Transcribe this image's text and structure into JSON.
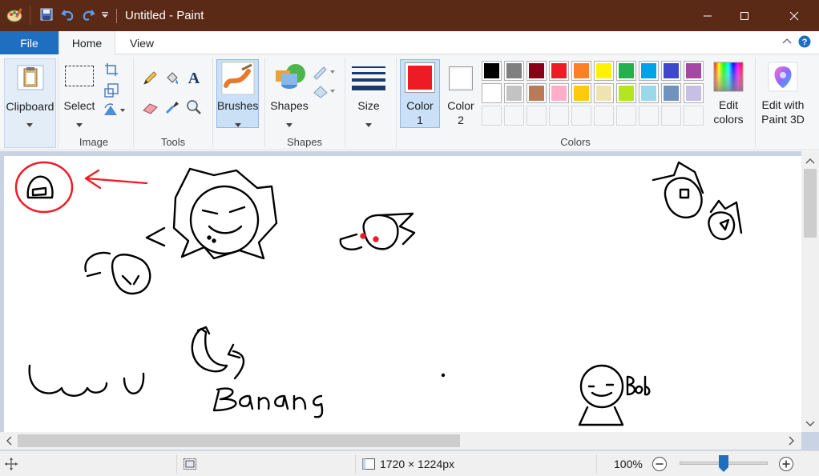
{
  "window": {
    "title": "Untitled - Paint",
    "qat_icons": [
      "paint-app-icon",
      "save-icon",
      "undo-icon",
      "redo-icon",
      "customize-qat-icon"
    ]
  },
  "tabs": {
    "file": "File",
    "home": "Home",
    "view": "View"
  },
  "ribbon": {
    "clipboard": {
      "label": "Clipboard"
    },
    "image": {
      "select_label": "Select",
      "group_label": "Image"
    },
    "tools": {
      "group_label": "Tools"
    },
    "brushes": {
      "label": "Brushes"
    },
    "shapes": {
      "label": "Shapes",
      "group_label": "Shapes"
    },
    "size": {
      "label": "Size"
    },
    "color1": {
      "label_line1": "Color",
      "label_line2": "1",
      "value": "#ed1c24"
    },
    "color2": {
      "label_line1": "Color",
      "label_line2": "2",
      "value": "#ffffff"
    },
    "colors_group_label": "Colors",
    "edit_colors": {
      "line1": "Edit",
      "line2": "colors"
    },
    "edit_3d": {
      "line1": "Edit with",
      "line2": "Paint 3D"
    },
    "palette_row1": [
      "#000000",
      "#7f7f7f",
      "#880015",
      "#ed1c24",
      "#ff7f27",
      "#fff200",
      "#22b14c",
      "#00a2e8",
      "#3f48cc",
      "#a349a4"
    ],
    "palette_row2": [
      "#ffffff",
      "#c3c3c3",
      "#b97a57",
      "#ffaec9",
      "#ffc90e",
      "#efe4b0",
      "#b5e61d",
      "#99d9ea",
      "#7092be",
      "#c8bfe7"
    ]
  },
  "canvas": {
    "doodle_words": [
      "UwU",
      "Banana",
      "Bob"
    ]
  },
  "status": {
    "image_size": "1720 × 1224px",
    "zoom": "100%",
    "zoom_level": 0.5
  }
}
